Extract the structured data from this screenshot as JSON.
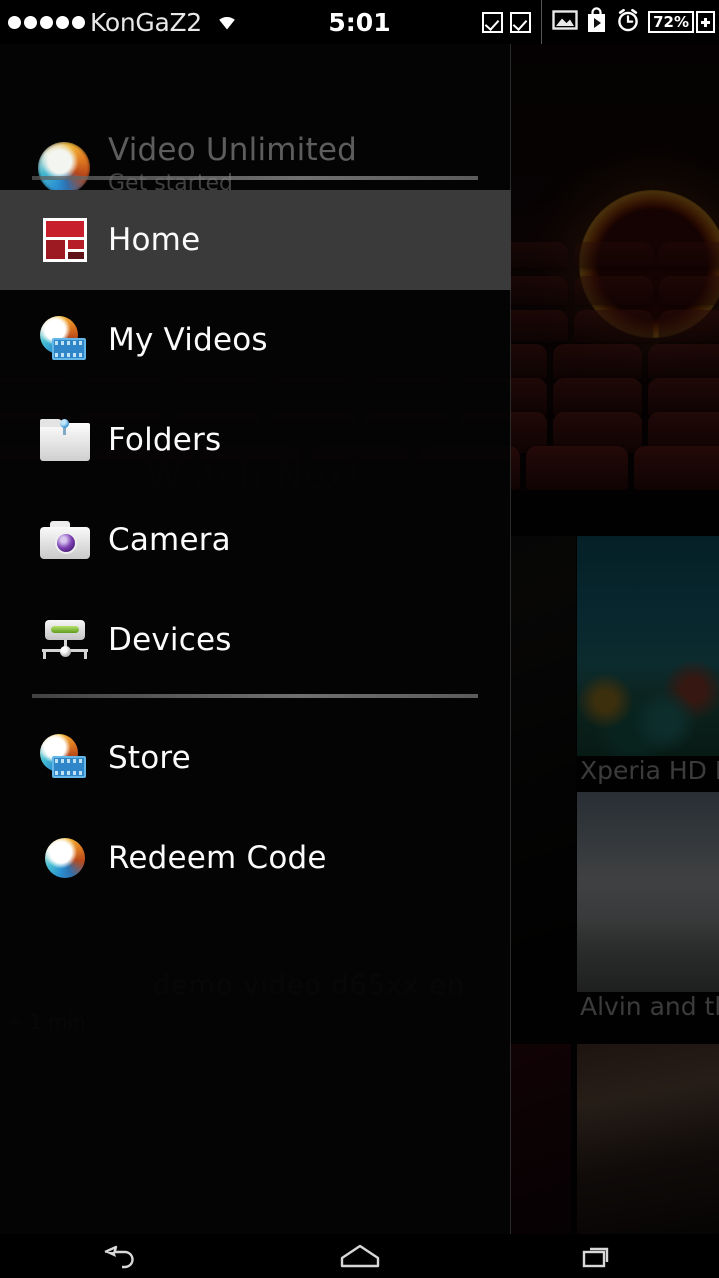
{
  "status_bar": {
    "signal_dots": 5,
    "carrier": "KonGaZ2",
    "wifi_icon": "wifi-icon",
    "clock": "5:01",
    "icons": [
      {
        "name": "checkbox-icon-1",
        "glyph": "checkbox"
      },
      {
        "name": "checkbox-icon-2",
        "glyph": "checkbox"
      },
      {
        "name": "image-icon",
        "glyph": "picture"
      },
      {
        "name": "play-store-icon",
        "glyph": "shopping-bag-play"
      },
      {
        "name": "alarm-clock-icon",
        "glyph": "alarm"
      }
    ],
    "battery_level": "72%",
    "battery_charging_icon": "battery-plus-icon"
  },
  "drawer": {
    "account": {
      "logo_icon": "sony-orb-icon",
      "title": "Video Unlimited",
      "subtitle": "Get started"
    },
    "items_group_1": [
      {
        "label": "Home",
        "icon": "home-grid-icon",
        "active": true
      },
      {
        "label": "My Videos",
        "icon": "orb-film-icon",
        "active": false
      },
      {
        "label": "Folders",
        "icon": "folder-icon",
        "active": false
      },
      {
        "label": "Camera",
        "icon": "camera-icon",
        "active": false
      },
      {
        "label": "Devices",
        "icon": "devices-icon",
        "active": false
      }
    ],
    "items_group_2": [
      {
        "label": "Store",
        "icon": "orb-film-icon",
        "active": false
      },
      {
        "label": "Redeem Code",
        "icon": "sony-orb-icon",
        "active": false
      }
    ]
  },
  "background_app": {
    "section_header": "Watch Next",
    "cards": [
      {
        "title": "demo video d65xx en",
        "duration": "1 min",
        "duration_icon": "star-icon"
      },
      {
        "title": "Xperia HD La"
      },
      {
        "title": "Alvin and the"
      }
    ]
  },
  "nav_bar": {
    "back_icon": "back-arrow-icon",
    "home_icon": "home-outline-icon",
    "recents_icon": "recent-apps-icon"
  },
  "colors": {
    "drawer_bg": "#040404",
    "active_row": "#3a3a3a",
    "accent_red": "#c7202c",
    "text": "#fbfbfb",
    "muted_text": "#5d5d5d"
  }
}
